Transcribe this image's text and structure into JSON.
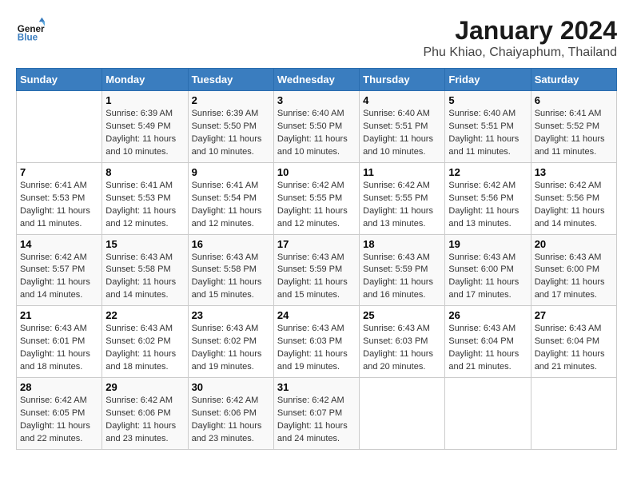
{
  "header": {
    "logo_line1": "General",
    "logo_line2": "Blue",
    "month": "January 2024",
    "location": "Phu Khiao, Chaiyaphum, Thailand"
  },
  "days_of_week": [
    "Sunday",
    "Monday",
    "Tuesday",
    "Wednesday",
    "Thursday",
    "Friday",
    "Saturday"
  ],
  "weeks": [
    [
      {
        "num": "",
        "info": ""
      },
      {
        "num": "1",
        "info": "Sunrise: 6:39 AM\nSunset: 5:49 PM\nDaylight: 11 hours\nand 10 minutes."
      },
      {
        "num": "2",
        "info": "Sunrise: 6:39 AM\nSunset: 5:50 PM\nDaylight: 11 hours\nand 10 minutes."
      },
      {
        "num": "3",
        "info": "Sunrise: 6:40 AM\nSunset: 5:50 PM\nDaylight: 11 hours\nand 10 minutes."
      },
      {
        "num": "4",
        "info": "Sunrise: 6:40 AM\nSunset: 5:51 PM\nDaylight: 11 hours\nand 10 minutes."
      },
      {
        "num": "5",
        "info": "Sunrise: 6:40 AM\nSunset: 5:51 PM\nDaylight: 11 hours\nand 11 minutes."
      },
      {
        "num": "6",
        "info": "Sunrise: 6:41 AM\nSunset: 5:52 PM\nDaylight: 11 hours\nand 11 minutes."
      }
    ],
    [
      {
        "num": "7",
        "info": "Sunrise: 6:41 AM\nSunset: 5:53 PM\nDaylight: 11 hours\nand 11 minutes."
      },
      {
        "num": "8",
        "info": "Sunrise: 6:41 AM\nSunset: 5:53 PM\nDaylight: 11 hours\nand 12 minutes."
      },
      {
        "num": "9",
        "info": "Sunrise: 6:41 AM\nSunset: 5:54 PM\nDaylight: 11 hours\nand 12 minutes."
      },
      {
        "num": "10",
        "info": "Sunrise: 6:42 AM\nSunset: 5:55 PM\nDaylight: 11 hours\nand 12 minutes."
      },
      {
        "num": "11",
        "info": "Sunrise: 6:42 AM\nSunset: 5:55 PM\nDaylight: 11 hours\nand 13 minutes."
      },
      {
        "num": "12",
        "info": "Sunrise: 6:42 AM\nSunset: 5:56 PM\nDaylight: 11 hours\nand 13 minutes."
      },
      {
        "num": "13",
        "info": "Sunrise: 6:42 AM\nSunset: 5:56 PM\nDaylight: 11 hours\nand 14 minutes."
      }
    ],
    [
      {
        "num": "14",
        "info": "Sunrise: 6:42 AM\nSunset: 5:57 PM\nDaylight: 11 hours\nand 14 minutes."
      },
      {
        "num": "15",
        "info": "Sunrise: 6:43 AM\nSunset: 5:58 PM\nDaylight: 11 hours\nand 14 minutes."
      },
      {
        "num": "16",
        "info": "Sunrise: 6:43 AM\nSunset: 5:58 PM\nDaylight: 11 hours\nand 15 minutes."
      },
      {
        "num": "17",
        "info": "Sunrise: 6:43 AM\nSunset: 5:59 PM\nDaylight: 11 hours\nand 15 minutes."
      },
      {
        "num": "18",
        "info": "Sunrise: 6:43 AM\nSunset: 5:59 PM\nDaylight: 11 hours\nand 16 minutes."
      },
      {
        "num": "19",
        "info": "Sunrise: 6:43 AM\nSunset: 6:00 PM\nDaylight: 11 hours\nand 17 minutes."
      },
      {
        "num": "20",
        "info": "Sunrise: 6:43 AM\nSunset: 6:00 PM\nDaylight: 11 hours\nand 17 minutes."
      }
    ],
    [
      {
        "num": "21",
        "info": "Sunrise: 6:43 AM\nSunset: 6:01 PM\nDaylight: 11 hours\nand 18 minutes."
      },
      {
        "num": "22",
        "info": "Sunrise: 6:43 AM\nSunset: 6:02 PM\nDaylight: 11 hours\nand 18 minutes."
      },
      {
        "num": "23",
        "info": "Sunrise: 6:43 AM\nSunset: 6:02 PM\nDaylight: 11 hours\nand 19 minutes."
      },
      {
        "num": "24",
        "info": "Sunrise: 6:43 AM\nSunset: 6:03 PM\nDaylight: 11 hours\nand 19 minutes."
      },
      {
        "num": "25",
        "info": "Sunrise: 6:43 AM\nSunset: 6:03 PM\nDaylight: 11 hours\nand 20 minutes."
      },
      {
        "num": "26",
        "info": "Sunrise: 6:43 AM\nSunset: 6:04 PM\nDaylight: 11 hours\nand 21 minutes."
      },
      {
        "num": "27",
        "info": "Sunrise: 6:43 AM\nSunset: 6:04 PM\nDaylight: 11 hours\nand 21 minutes."
      }
    ],
    [
      {
        "num": "28",
        "info": "Sunrise: 6:42 AM\nSunset: 6:05 PM\nDaylight: 11 hours\nand 22 minutes."
      },
      {
        "num": "29",
        "info": "Sunrise: 6:42 AM\nSunset: 6:06 PM\nDaylight: 11 hours\nand 23 minutes."
      },
      {
        "num": "30",
        "info": "Sunrise: 6:42 AM\nSunset: 6:06 PM\nDaylight: 11 hours\nand 23 minutes."
      },
      {
        "num": "31",
        "info": "Sunrise: 6:42 AM\nSunset: 6:07 PM\nDaylight: 11 hours\nand 24 minutes."
      },
      {
        "num": "",
        "info": ""
      },
      {
        "num": "",
        "info": ""
      },
      {
        "num": "",
        "info": ""
      }
    ]
  ]
}
